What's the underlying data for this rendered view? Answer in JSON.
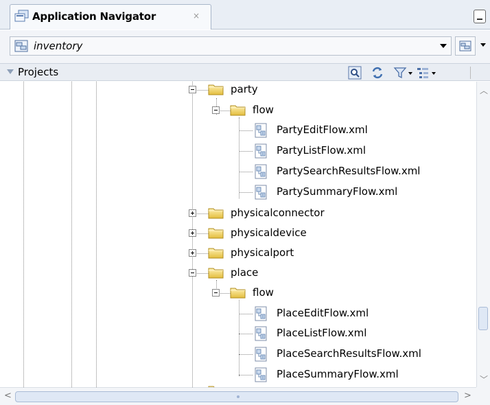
{
  "panel": {
    "title": "Application Navigator",
    "close_glyph": "×"
  },
  "application": {
    "name": "inventory"
  },
  "projects": {
    "label": "Projects"
  },
  "tree": {
    "party": "party",
    "party_flow": "flow",
    "party_files": [
      "PartyEditFlow.xml",
      "PartyListFlow.xml",
      "PartySearchResultsFlow.xml",
      "PartySummaryFlow.xml"
    ],
    "physicalconnector": "physicalconnector",
    "physicaldevice": "physicaldevice",
    "physicalport": "physicalport",
    "place": "place",
    "place_flow": "flow",
    "place_files": [
      "PlaceEditFlow.xml",
      "PlaceListFlow.xml",
      "PlaceSearchResultsFlow.xml",
      "PlaceSummaryFlow.xml"
    ]
  },
  "icons": {
    "tab": "application-navigator-icon",
    "app": "application-icon",
    "find": "find-icon",
    "refresh": "refresh-icon",
    "filter": "filter-icon",
    "layout": "tree-layout-icon",
    "folder": "folder-icon",
    "xml": "xml-file-icon"
  },
  "colors": {
    "folder": "#f2d675",
    "xml_icon": "#6f8fb8"
  }
}
